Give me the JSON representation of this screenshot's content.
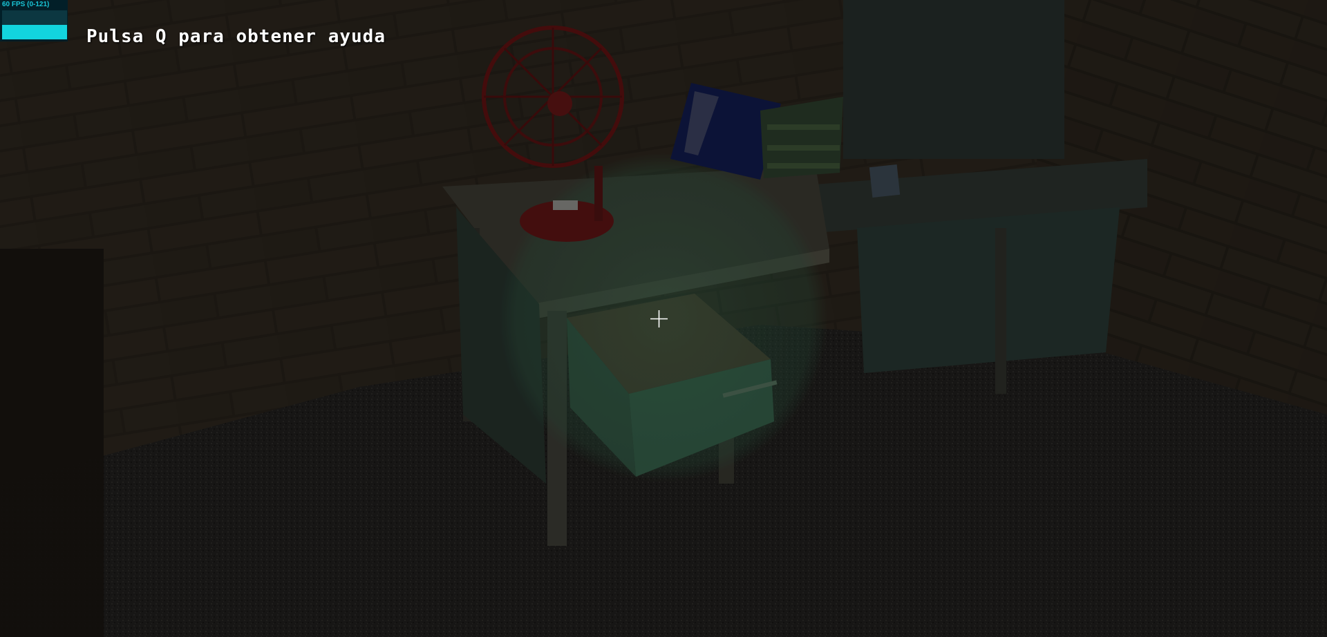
{
  "hud": {
    "help_hint": "Pulsa Q para obtener ayuda",
    "fps_label": "60 FPS (0-121)",
    "fps_graph_fill": 0.5
  },
  "scene": {
    "description_objects": [
      "brick-wall",
      "table",
      "fan",
      "books",
      "open-drawer",
      "carpet-floor"
    ]
  },
  "colors": {
    "fps_text": "#19d3e6",
    "fps_bar": "#12e4f0",
    "hint_text": "#ffffff",
    "highlight": "#3a6f52"
  },
  "icons": {
    "crosshair": "crosshair-icon"
  }
}
